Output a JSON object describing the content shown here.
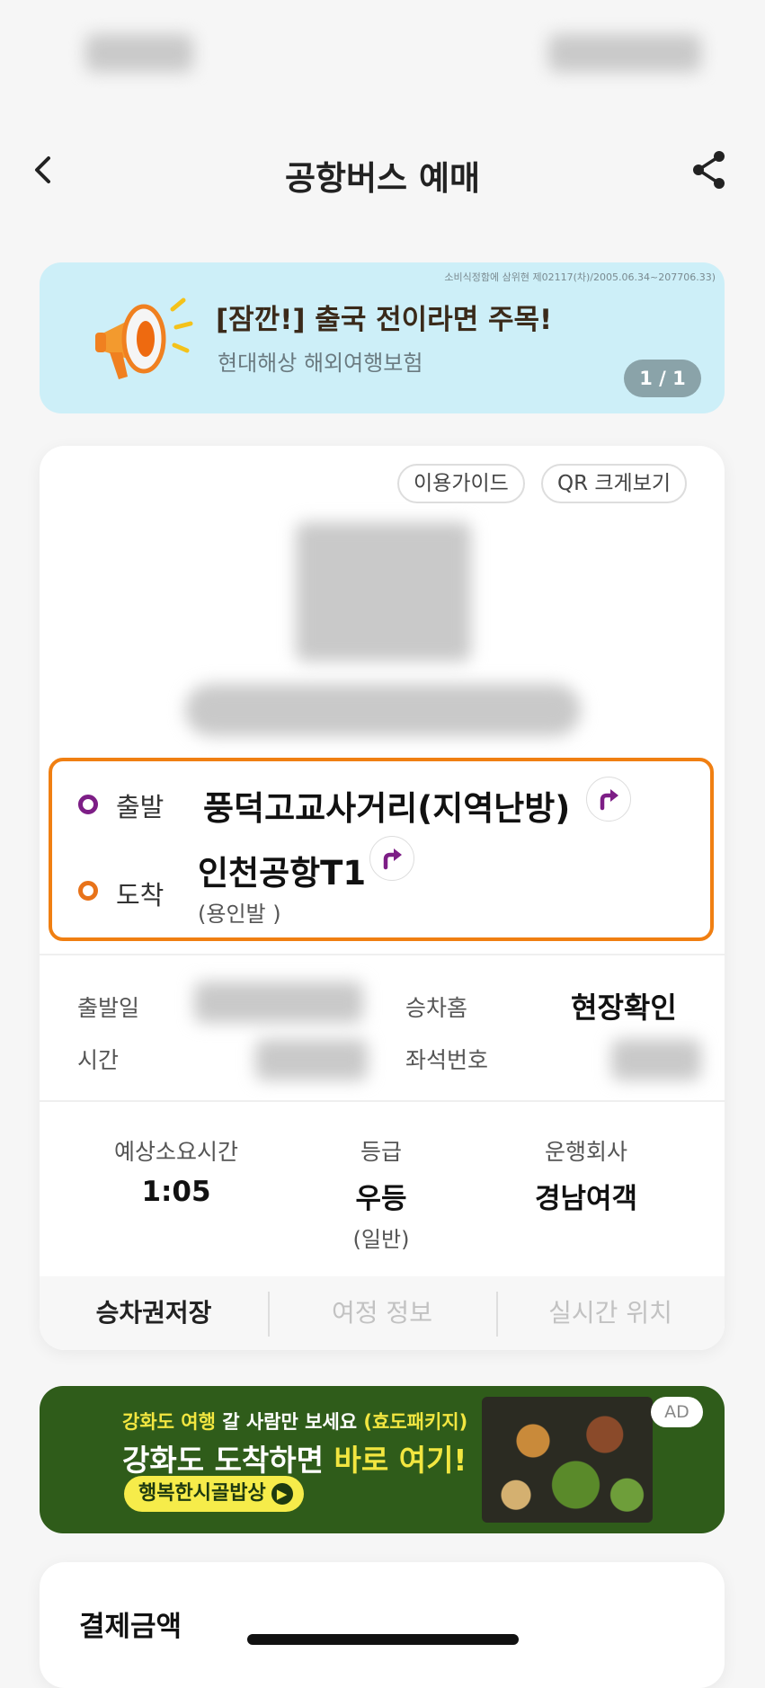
{
  "header": {
    "title": "공항버스 예매",
    "back_icon": "chevron-left-icon",
    "share_icon": "share-icon"
  },
  "promo": {
    "fine_print": "소비식정함에 삼위현 제02117(차)/2005.06.34~207706.33)",
    "title": "[잠깐!] 출국 전이라면 주목!",
    "subtitle": "현대해상 해외여행보험",
    "counter": "1 / 1",
    "icon": "megaphone-icon"
  },
  "ticket": {
    "guide_label": "이용가이드",
    "qr_label": "QR 크게보기",
    "route": {
      "departure_label": "출발",
      "departure_stop": "풍덕고교사거리(지역난방)",
      "arrival_label": "도착",
      "arrival_stop": "인천공항T1",
      "arrival_note": "(용인발 )"
    },
    "info": {
      "date_label": "출발일",
      "time_label": "시간",
      "platform_label": "승차홈",
      "platform_value": "현장확인",
      "seat_label": "좌석번호"
    },
    "stats": {
      "duration_label": "예상소요시간",
      "duration_value": "1:05",
      "grade_label": "등급",
      "grade_value": "우등",
      "grade_sub": "(일반)",
      "company_label": "운행회사",
      "company_value": "경남여객"
    },
    "tabs": [
      "승차권저장",
      "여정 정보",
      "실시간 위치"
    ]
  },
  "ad": {
    "line1_pre": "강화도 여행",
    "line1_mid": " 갈 사람만 보세요 ",
    "line1_post": "(효도패키지)",
    "line2_pre": "강화도 도착하면 ",
    "line2_post": "바로 여기!",
    "cta": "행복한시골밥상",
    "badge": "AD"
  },
  "payment": {
    "title": "결제금액"
  },
  "colors": {
    "accent_orange": "#f07f12",
    "departure_dot": "#7d1e86",
    "arrival_dot": "#e8731a",
    "promo_bg": "#cdeff8",
    "ad_bg": "#2f5c1a"
  }
}
